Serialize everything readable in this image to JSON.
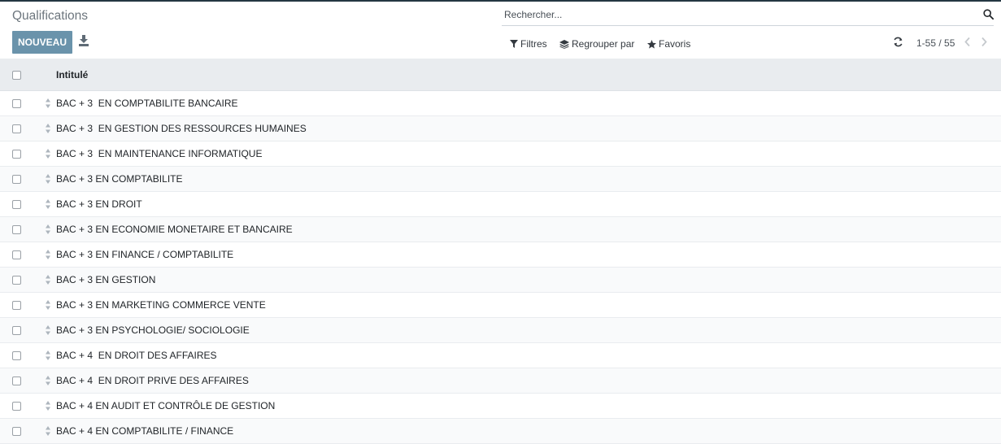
{
  "header": {
    "title": "Qualifications",
    "new_button": "NOUVEAU"
  },
  "search": {
    "placeholder": "Rechercher..."
  },
  "filters": {
    "filters_label": "Filtres",
    "group_by_label": "Regrouper par",
    "favorites_label": "Favoris"
  },
  "pager": {
    "value": "1-55 / 55"
  },
  "table": {
    "column_header": "Intitulé",
    "rows": [
      "BAC + 3  EN COMPTABILITE BANCAIRE",
      "BAC + 3  EN GESTION DES RESSOURCES HUMAINES",
      "BAC + 3  EN MAINTENANCE INFORMATIQUE",
      "BAC + 3 EN COMPTABILITE",
      "BAC + 3 EN DROIT",
      "BAC + 3 EN ECONOMIE MONETAIRE ET BANCAIRE",
      "BAC + 3 EN FINANCE / COMPTABILITE",
      "BAC + 3 EN GESTION",
      "BAC + 3 EN MARKETING COMMERCE VENTE",
      "BAC + 3 EN PSYCHOLOGIE/ SOCIOLOGIE",
      "BAC + 4  EN DROIT DES AFFAIRES",
      "BAC + 4  EN DROIT PRIVE DES AFFAIRES",
      "BAC + 4 EN AUDIT ET CONTRÔLE DE GESTION",
      "BAC + 4 EN COMPTABILITE / FINANCE"
    ]
  },
  "colors": {
    "primary_button": "#6a93ab",
    "header_background": "#e9ecef",
    "top_bar": "#243742"
  }
}
